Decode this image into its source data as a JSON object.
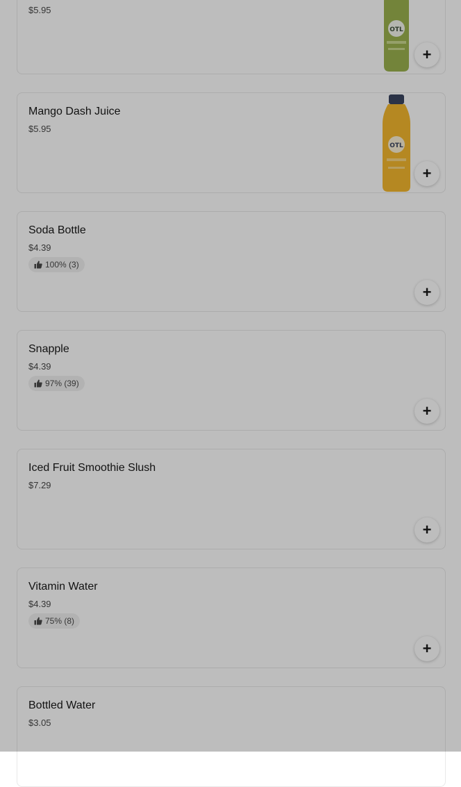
{
  "items": [
    {
      "name": "",
      "price": "$5.95",
      "rating": "",
      "image": "green-juice-bottle",
      "label_color": "#9bb24f"
    },
    {
      "name": "Mango Dash Juice",
      "price": "$5.95",
      "rating": "",
      "image": "mango-juice-bottle",
      "label_color": "#f5b82e"
    },
    {
      "name": "Soda Bottle",
      "price": "$4.39",
      "rating": "100% (3)",
      "image": ""
    },
    {
      "name": "Snapple",
      "price": "$4.39",
      "rating": "97% (39)",
      "image": ""
    },
    {
      "name": "Iced Fruit Smoothie Slush",
      "price": "$7.29",
      "rating": "",
      "image": ""
    },
    {
      "name": "Vitamin Water",
      "price": "$4.39",
      "rating": "75% (8)",
      "image": ""
    },
    {
      "name": "Bottled Water",
      "price": "$3.05",
      "rating": "",
      "image": ""
    }
  ],
  "add_button_label": "+",
  "icons": {
    "add": "plus-icon",
    "rating": "thumbs-up-icon"
  },
  "colors": {
    "overlay": "#000000",
    "card_border": "#e8e8e8",
    "text": "#191919"
  }
}
